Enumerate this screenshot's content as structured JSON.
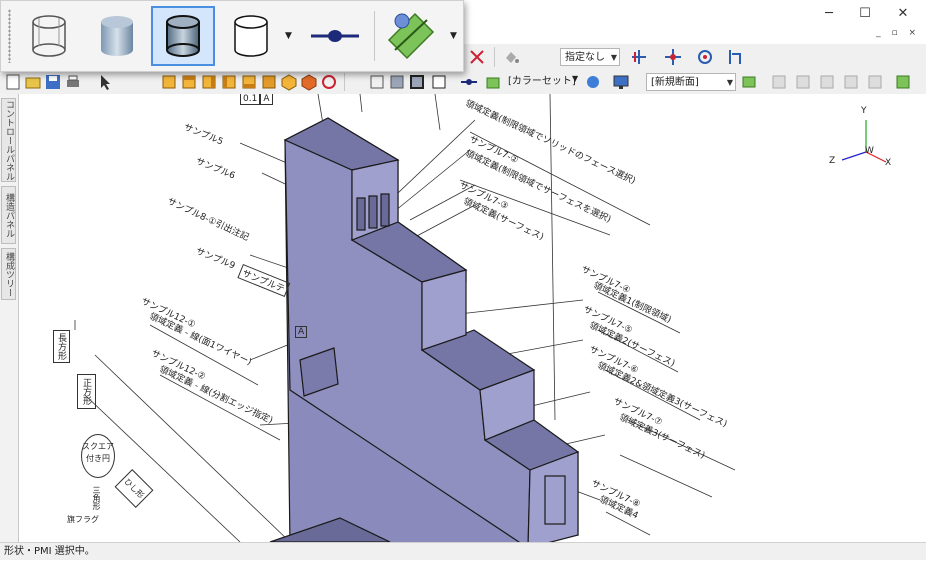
{
  "window": {
    "minimize_icon": "minimize-icon",
    "maximize_icon": "maximize-icon",
    "close_icon": "close-icon"
  },
  "mdi": {
    "buttons": "_ ▫ ×"
  },
  "toolbar": {
    "layer_filter_value": "指定なし",
    "color_set_label": "[カラーセット]",
    "view_section_value": "[新規断面]"
  },
  "floating_toolbar": {
    "buttons": [
      "wireframe-cylinder-icon",
      "shaded-cylinder-icon",
      "shaded-edges-cylinder-icon",
      "hidden-line-cylinder-icon",
      "line-with-point-icon",
      "section-plane-icon"
    ]
  },
  "sidebar": {
    "tabs": [
      "コントロールパネル",
      "構造パネル",
      "構成ツリー"
    ]
  },
  "axis": {
    "x": "X",
    "y": "Y",
    "z": "Z",
    "w": "W"
  },
  "annotations": {
    "leaders": [
      "サンプル5",
      "サンプル6",
      "サンプル8-①引出注記",
      "サンプル9",
      "サンプルテ",
      "サンプル12-①",
      "領域定義 - 線(面1ワイヤー)",
      "サンプル12-②",
      "領域定義 - 線(分割エッジ指定)",
      "領域定義(制限領域でソリッドのフェース選択)",
      "サンプル7-②",
      "領域定義(制限領域でサーフェスを選択)",
      "サンプル7-③",
      "領域定義(サーフェス)",
      "サンプル7-④",
      "領域定義1(制限領域)",
      "サンプル7-⑤",
      "領域定義2(サーフェス)",
      "サンプル7-⑥",
      "領域定義2&領域定義3(サーフェス)",
      "サンプル7-⑦",
      "領域定義3(サーフェス)",
      "サンプル7-⑧",
      "領域定義4"
    ],
    "left_notes": [
      "長方形",
      "正方形",
      "スクエア付き円",
      "三角形",
      "ひし形",
      "旗フラグ"
    ],
    "symbols": [
      "0.1",
      "A",
      "A"
    ]
  },
  "status": {
    "text": "形状・PMI 選択中。"
  },
  "colors": {
    "solid_face": "#8f8fbd",
    "solid_dark": "#6e6e99",
    "solid_top": "#7b7bab",
    "selected": "#d3e6fb"
  }
}
